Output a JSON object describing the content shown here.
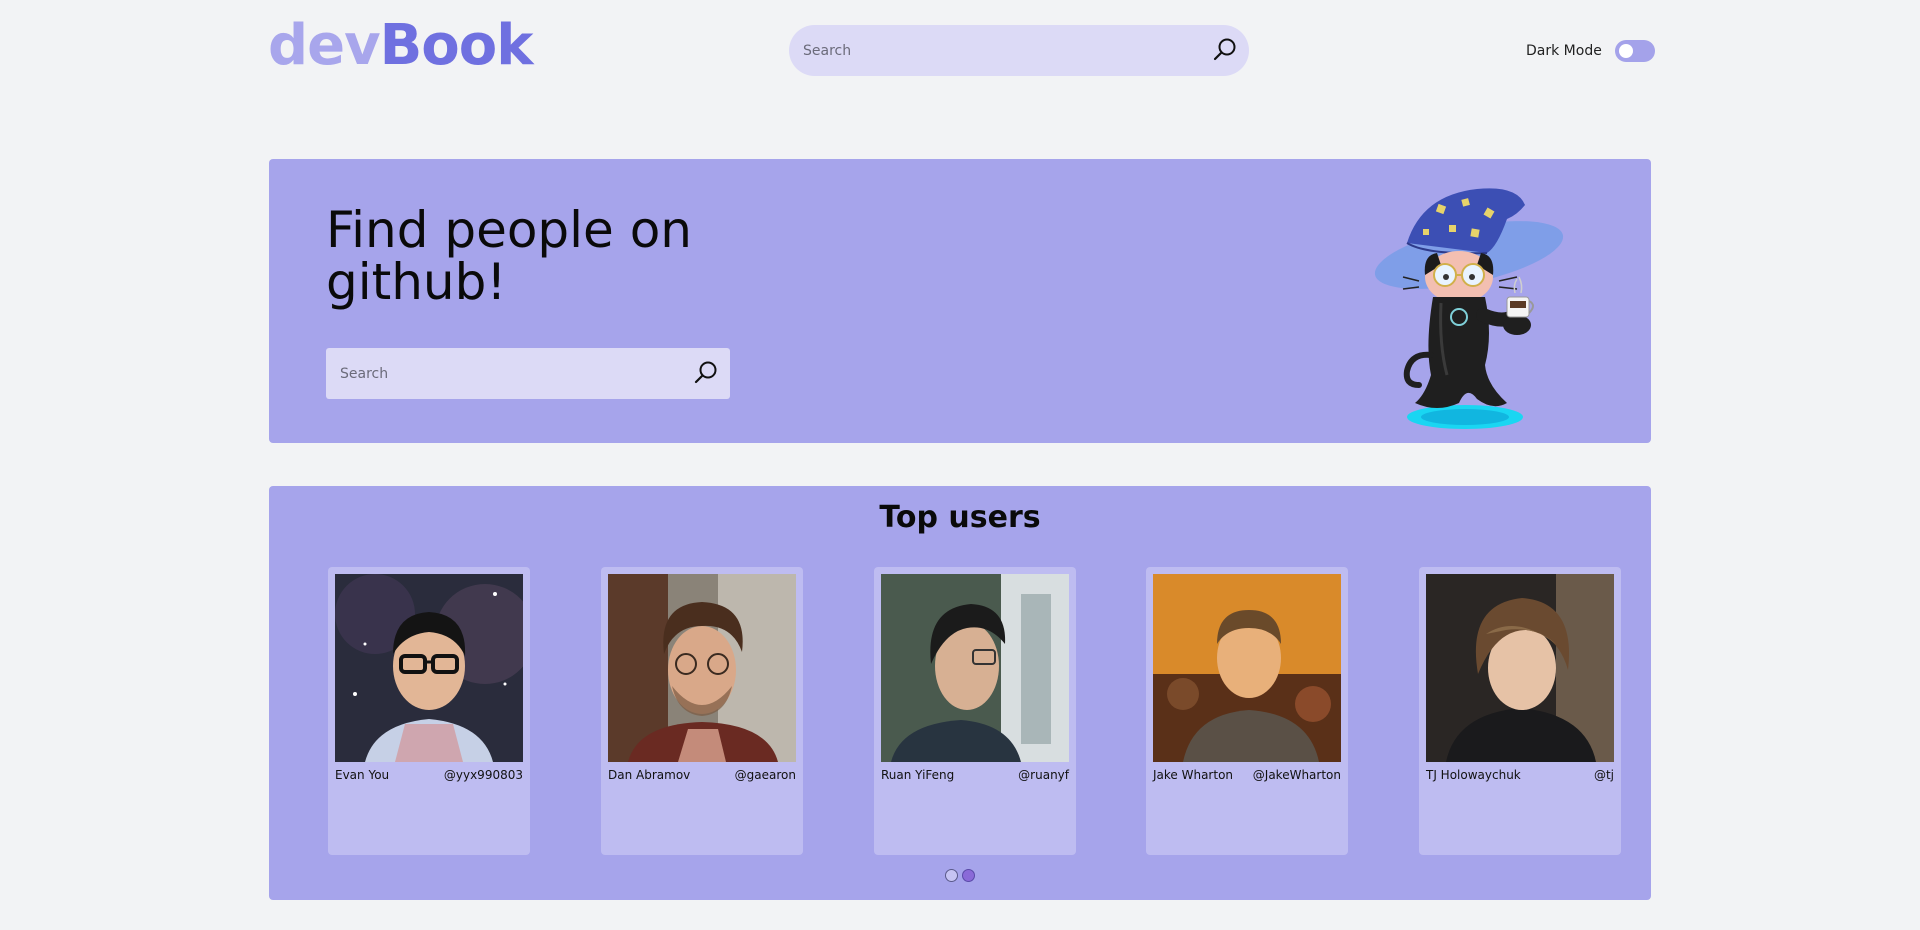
{
  "header": {
    "logo_dev": "dev",
    "logo_book": "Book",
    "search_placeholder": "Search",
    "dark_mode_label": "Dark Mode",
    "dark_mode_on": false
  },
  "hero": {
    "title": "Find people on github!",
    "search_placeholder": "Search",
    "mascot_icon": "octocat-wizard-icon"
  },
  "top_users": {
    "title": "Top users",
    "users": [
      {
        "name": "Evan You",
        "handle": "@yyx990803"
      },
      {
        "name": "Dan Abramov",
        "handle": "@gaearon"
      },
      {
        "name": "Ruan YiFeng",
        "handle": "@ruanyf"
      },
      {
        "name": "Jake Wharton",
        "handle": "@JakeWharton"
      },
      {
        "name": "TJ Holowaychuk",
        "handle": "@tj"
      }
    ],
    "pagination": {
      "pages": 2,
      "current": 2
    }
  },
  "colors": {
    "background": "#f2f3f5",
    "panel": "#a6a4eb",
    "search_bg": "#dcdaf6",
    "card_bg": "#bebcf1",
    "logo_light": "#a8a6ec",
    "logo_dark": "#6f70e0"
  }
}
